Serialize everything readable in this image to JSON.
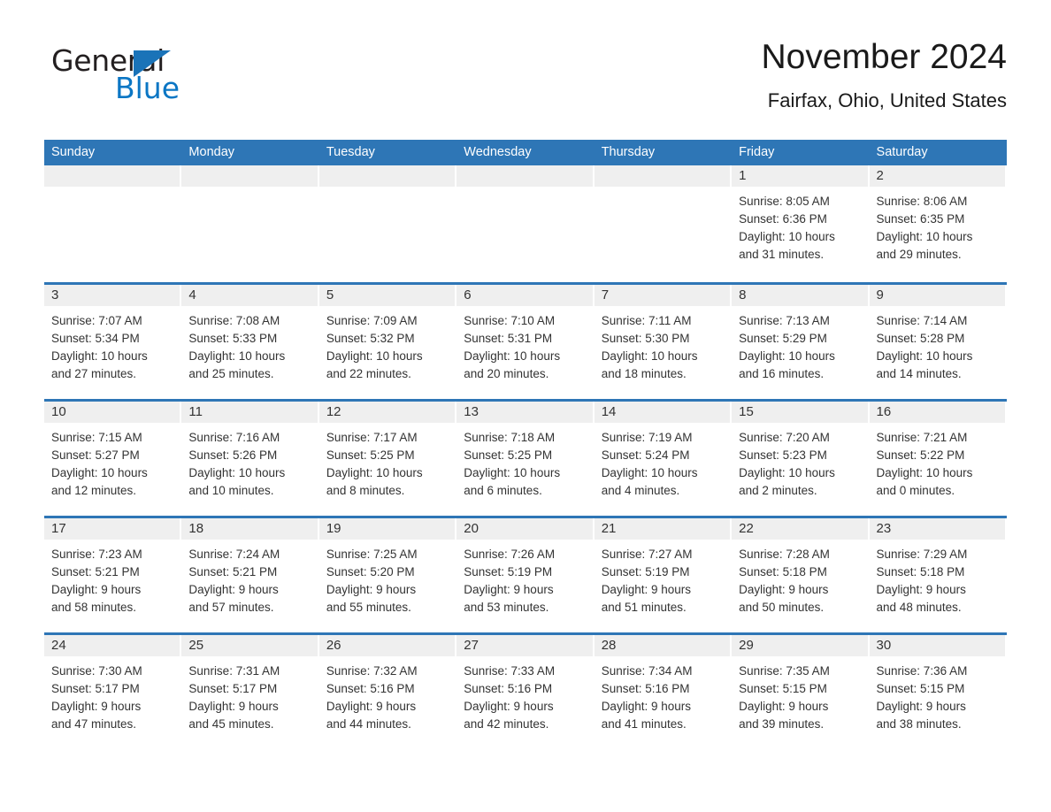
{
  "brand": {
    "name_part1": "General",
    "name_part2": "Blue",
    "accent_color": "#0b76c4",
    "triangle_color": "#1a73b8"
  },
  "header": {
    "month_title": "November 2024",
    "location": "Fairfax, Ohio, United States"
  },
  "theme": {
    "header_blue": "#2e76b6",
    "day_band_gray": "#efefef",
    "text_color": "#333333"
  },
  "weekdays": [
    "Sunday",
    "Monday",
    "Tuesday",
    "Wednesday",
    "Thursday",
    "Friday",
    "Saturday"
  ],
  "weeks": [
    [
      {
        "day": "",
        "sunrise": "",
        "sunset": "",
        "daylight_line1": "",
        "daylight_line2": ""
      },
      {
        "day": "",
        "sunrise": "",
        "sunset": "",
        "daylight_line1": "",
        "daylight_line2": ""
      },
      {
        "day": "",
        "sunrise": "",
        "sunset": "",
        "daylight_line1": "",
        "daylight_line2": ""
      },
      {
        "day": "",
        "sunrise": "",
        "sunset": "",
        "daylight_line1": "",
        "daylight_line2": ""
      },
      {
        "day": "",
        "sunrise": "",
        "sunset": "",
        "daylight_line1": "",
        "daylight_line2": ""
      },
      {
        "day": "1",
        "sunrise": "Sunrise: 8:05 AM",
        "sunset": "Sunset: 6:36 PM",
        "daylight_line1": "Daylight: 10 hours",
        "daylight_line2": "and 31 minutes."
      },
      {
        "day": "2",
        "sunrise": "Sunrise: 8:06 AM",
        "sunset": "Sunset: 6:35 PM",
        "daylight_line1": "Daylight: 10 hours",
        "daylight_line2": "and 29 minutes."
      }
    ],
    [
      {
        "day": "3",
        "sunrise": "Sunrise: 7:07 AM",
        "sunset": "Sunset: 5:34 PM",
        "daylight_line1": "Daylight: 10 hours",
        "daylight_line2": "and 27 minutes."
      },
      {
        "day": "4",
        "sunrise": "Sunrise: 7:08 AM",
        "sunset": "Sunset: 5:33 PM",
        "daylight_line1": "Daylight: 10 hours",
        "daylight_line2": "and 25 minutes."
      },
      {
        "day": "5",
        "sunrise": "Sunrise: 7:09 AM",
        "sunset": "Sunset: 5:32 PM",
        "daylight_line1": "Daylight: 10 hours",
        "daylight_line2": "and 22 minutes."
      },
      {
        "day": "6",
        "sunrise": "Sunrise: 7:10 AM",
        "sunset": "Sunset: 5:31 PM",
        "daylight_line1": "Daylight: 10 hours",
        "daylight_line2": "and 20 minutes."
      },
      {
        "day": "7",
        "sunrise": "Sunrise: 7:11 AM",
        "sunset": "Sunset: 5:30 PM",
        "daylight_line1": "Daylight: 10 hours",
        "daylight_line2": "and 18 minutes."
      },
      {
        "day": "8",
        "sunrise": "Sunrise: 7:13 AM",
        "sunset": "Sunset: 5:29 PM",
        "daylight_line1": "Daylight: 10 hours",
        "daylight_line2": "and 16 minutes."
      },
      {
        "day": "9",
        "sunrise": "Sunrise: 7:14 AM",
        "sunset": "Sunset: 5:28 PM",
        "daylight_line1": "Daylight: 10 hours",
        "daylight_line2": "and 14 minutes."
      }
    ],
    [
      {
        "day": "10",
        "sunrise": "Sunrise: 7:15 AM",
        "sunset": "Sunset: 5:27 PM",
        "daylight_line1": "Daylight: 10 hours",
        "daylight_line2": "and 12 minutes."
      },
      {
        "day": "11",
        "sunrise": "Sunrise: 7:16 AM",
        "sunset": "Sunset: 5:26 PM",
        "daylight_line1": "Daylight: 10 hours",
        "daylight_line2": "and 10 minutes."
      },
      {
        "day": "12",
        "sunrise": "Sunrise: 7:17 AM",
        "sunset": "Sunset: 5:25 PM",
        "daylight_line1": "Daylight: 10 hours",
        "daylight_line2": "and 8 minutes."
      },
      {
        "day": "13",
        "sunrise": "Sunrise: 7:18 AM",
        "sunset": "Sunset: 5:25 PM",
        "daylight_line1": "Daylight: 10 hours",
        "daylight_line2": "and 6 minutes."
      },
      {
        "day": "14",
        "sunrise": "Sunrise: 7:19 AM",
        "sunset": "Sunset: 5:24 PM",
        "daylight_line1": "Daylight: 10 hours",
        "daylight_line2": "and 4 minutes."
      },
      {
        "day": "15",
        "sunrise": "Sunrise: 7:20 AM",
        "sunset": "Sunset: 5:23 PM",
        "daylight_line1": "Daylight: 10 hours",
        "daylight_line2": "and 2 minutes."
      },
      {
        "day": "16",
        "sunrise": "Sunrise: 7:21 AM",
        "sunset": "Sunset: 5:22 PM",
        "daylight_line1": "Daylight: 10 hours",
        "daylight_line2": "and 0 minutes."
      }
    ],
    [
      {
        "day": "17",
        "sunrise": "Sunrise: 7:23 AM",
        "sunset": "Sunset: 5:21 PM",
        "daylight_line1": "Daylight: 9 hours",
        "daylight_line2": "and 58 minutes."
      },
      {
        "day": "18",
        "sunrise": "Sunrise: 7:24 AM",
        "sunset": "Sunset: 5:21 PM",
        "daylight_line1": "Daylight: 9 hours",
        "daylight_line2": "and 57 minutes."
      },
      {
        "day": "19",
        "sunrise": "Sunrise: 7:25 AM",
        "sunset": "Sunset: 5:20 PM",
        "daylight_line1": "Daylight: 9 hours",
        "daylight_line2": "and 55 minutes."
      },
      {
        "day": "20",
        "sunrise": "Sunrise: 7:26 AM",
        "sunset": "Sunset: 5:19 PM",
        "daylight_line1": "Daylight: 9 hours",
        "daylight_line2": "and 53 minutes."
      },
      {
        "day": "21",
        "sunrise": "Sunrise: 7:27 AM",
        "sunset": "Sunset: 5:19 PM",
        "daylight_line1": "Daylight: 9 hours",
        "daylight_line2": "and 51 minutes."
      },
      {
        "day": "22",
        "sunrise": "Sunrise: 7:28 AM",
        "sunset": "Sunset: 5:18 PM",
        "daylight_line1": "Daylight: 9 hours",
        "daylight_line2": "and 50 minutes."
      },
      {
        "day": "23",
        "sunrise": "Sunrise: 7:29 AM",
        "sunset": "Sunset: 5:18 PM",
        "daylight_line1": "Daylight: 9 hours",
        "daylight_line2": "and 48 minutes."
      }
    ],
    [
      {
        "day": "24",
        "sunrise": "Sunrise: 7:30 AM",
        "sunset": "Sunset: 5:17 PM",
        "daylight_line1": "Daylight: 9 hours",
        "daylight_line2": "and 47 minutes."
      },
      {
        "day": "25",
        "sunrise": "Sunrise: 7:31 AM",
        "sunset": "Sunset: 5:17 PM",
        "daylight_line1": "Daylight: 9 hours",
        "daylight_line2": "and 45 minutes."
      },
      {
        "day": "26",
        "sunrise": "Sunrise: 7:32 AM",
        "sunset": "Sunset: 5:16 PM",
        "daylight_line1": "Daylight: 9 hours",
        "daylight_line2": "and 44 minutes."
      },
      {
        "day": "27",
        "sunrise": "Sunrise: 7:33 AM",
        "sunset": "Sunset: 5:16 PM",
        "daylight_line1": "Daylight: 9 hours",
        "daylight_line2": "and 42 minutes."
      },
      {
        "day": "28",
        "sunrise": "Sunrise: 7:34 AM",
        "sunset": "Sunset: 5:16 PM",
        "daylight_line1": "Daylight: 9 hours",
        "daylight_line2": "and 41 minutes."
      },
      {
        "day": "29",
        "sunrise": "Sunrise: 7:35 AM",
        "sunset": "Sunset: 5:15 PM",
        "daylight_line1": "Daylight: 9 hours",
        "daylight_line2": "and 39 minutes."
      },
      {
        "day": "30",
        "sunrise": "Sunrise: 7:36 AM",
        "sunset": "Sunset: 5:15 PM",
        "daylight_line1": "Daylight: 9 hours",
        "daylight_line2": "and 38 minutes."
      }
    ]
  ]
}
